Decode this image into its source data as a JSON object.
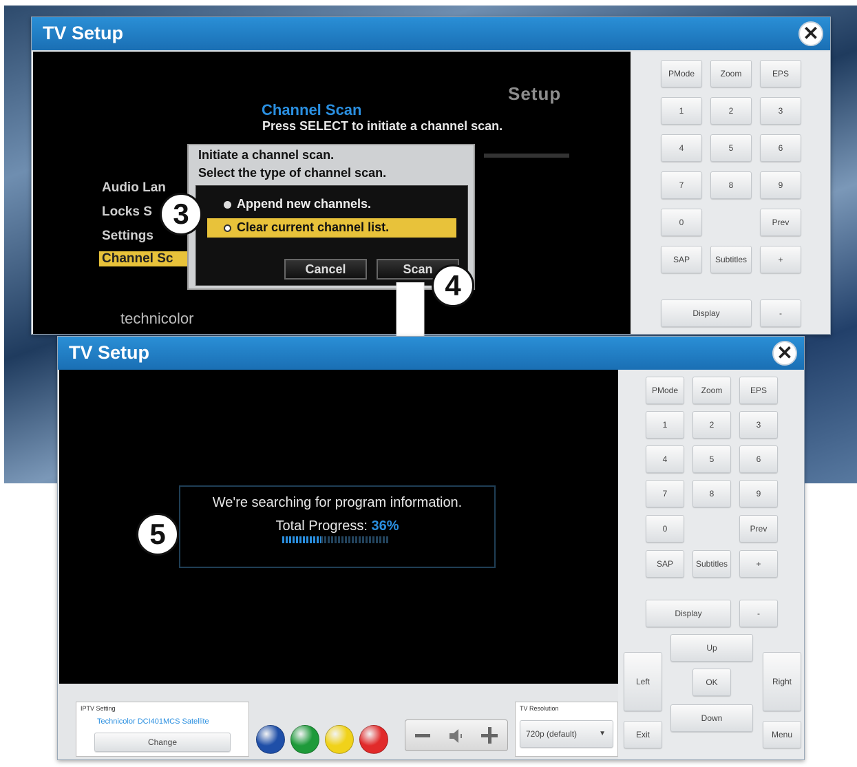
{
  "top_window": {
    "title": "TV Setup",
    "close_icon": "close-icon",
    "screen": {
      "header": "Setup",
      "section_title": "Channel Scan",
      "instruction": "Press SELECT to initiate a channel scan.",
      "menu": [
        "Audio Lan",
        "Locks S",
        "Settings",
        "Channel Sc"
      ],
      "selected_menu_index": 3,
      "brand": "technicolor",
      "dialog": {
        "line1": "Initiate a channel scan.",
        "line2": "Select the type of channel scan.",
        "options": [
          "Append new channels.",
          "Clear current channel list."
        ],
        "selected_option_index": 1,
        "cancel_label": "Cancel",
        "scan_label": "Scan"
      }
    },
    "keypad": [
      "PMode",
      "Zoom",
      "EPS",
      "1",
      "2",
      "3",
      "4",
      "5",
      "6",
      "7",
      "8",
      "9",
      "0",
      "Prev",
      "SAP",
      "Subtitles",
      "+",
      "Display",
      "-"
    ]
  },
  "steps": {
    "s3": "3",
    "s4": "4",
    "s5": "5"
  },
  "bottom_window": {
    "title": "TV Setup",
    "close_icon": "close-icon",
    "progress": {
      "message": "We're searching for program information.",
      "label": "Total Progress:",
      "percent_text": "36%",
      "percent": 36
    },
    "keypad": [
      "PMode",
      "Zoom",
      "EPS",
      "1",
      "2",
      "3",
      "4",
      "5",
      "6",
      "7",
      "8",
      "9",
      "0",
      "Prev",
      "SAP",
      "Subtitles",
      "+",
      "Display",
      "-"
    ],
    "nav": {
      "up": "Up",
      "left": "Left",
      "ok": "OK",
      "right": "Right",
      "down": "Down",
      "exit": "Exit",
      "menu": "Menu"
    },
    "iptv": {
      "heading": "IPTV Setting",
      "provider": "Technicolor DCI401MCS Satellite",
      "change_label": "Change"
    },
    "color_buttons": [
      "#1f4fa8",
      "#1e9a3a",
      "#f0d21a",
      "#e12a2a"
    ],
    "volume_icons": [
      "minus-icon",
      "speaker-icon",
      "plus-icon"
    ],
    "resolution": {
      "heading": "TV Resolution",
      "value": "720p (default)"
    }
  }
}
